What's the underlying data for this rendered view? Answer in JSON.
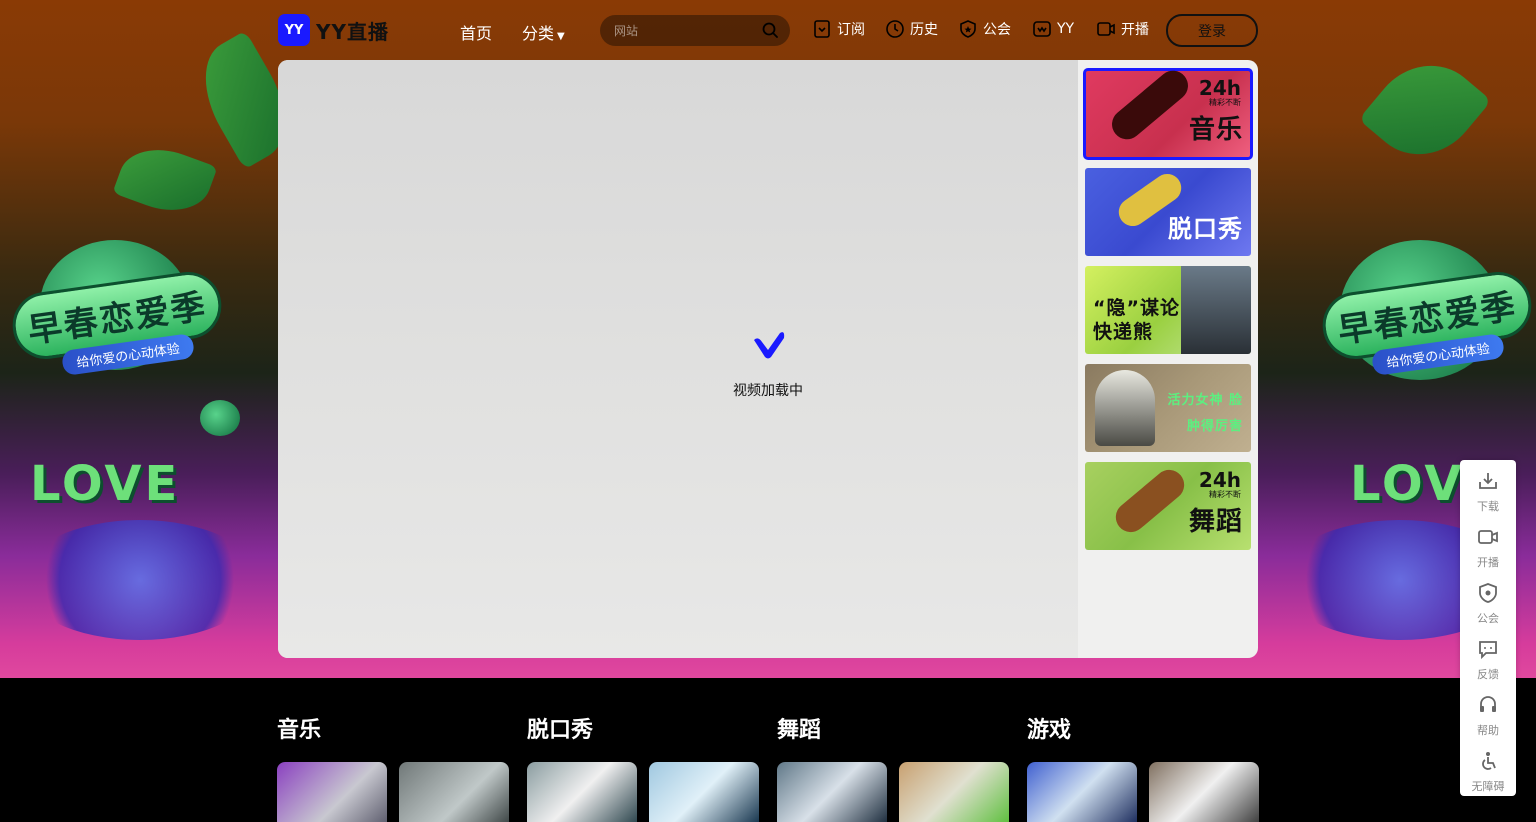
{
  "header": {
    "logo_mark": "YY",
    "logo_text": "YY直播",
    "nav": [
      {
        "label": "首页"
      },
      {
        "label": "分类"
      }
    ],
    "search": {
      "placeholder": "网站",
      "icon": "search-icon"
    },
    "actions": [
      {
        "label": "订阅",
        "icon": "bookmark-icon"
      },
      {
        "label": "历史",
        "icon": "clock-icon"
      },
      {
        "label": "公会",
        "icon": "shield-star-icon"
      },
      {
        "label": "YY",
        "icon": "yy-heart-icon"
      },
      {
        "label": "开播",
        "icon": "video-camera-icon"
      }
    ],
    "login_label": "登录"
  },
  "player": {
    "loading_text": "视频加载中",
    "loading_icon": "yy-check-icon",
    "thumbnails": [
      {
        "label": "音乐",
        "badge": "24h",
        "badge_sub": "精彩不断",
        "active": true
      },
      {
        "label": "脱口秀"
      },
      {
        "label": "“隐”谋论快递熊"
      },
      {
        "label": "活力女神 脸肿得厉害"
      },
      {
        "label": "舞蹈",
        "badge": "24h",
        "badge_sub": "精彩不断"
      }
    ]
  },
  "hero_decor": {
    "badge_text": "早春恋爱季",
    "ribbon_text": "给你爱の心动体验",
    "love_text": "LOVE"
  },
  "categories": [
    {
      "title": "音乐"
    },
    {
      "title": "脱口秀"
    },
    {
      "title": "舞蹈"
    },
    {
      "title": "游戏"
    }
  ],
  "sidebar": [
    {
      "label": "下载",
      "icon": "download-icon"
    },
    {
      "label": "开播",
      "icon": "video-camera-icon"
    },
    {
      "label": "公会",
      "icon": "shield-star-icon"
    },
    {
      "label": "反馈",
      "icon": "feedback-icon"
    },
    {
      "label": "帮助",
      "icon": "headset-icon"
    },
    {
      "label": "无障碍",
      "icon": "accessibility-icon"
    }
  ],
  "colors": {
    "brand": "#1a1aff",
    "accent_pink": "#e0489e"
  }
}
